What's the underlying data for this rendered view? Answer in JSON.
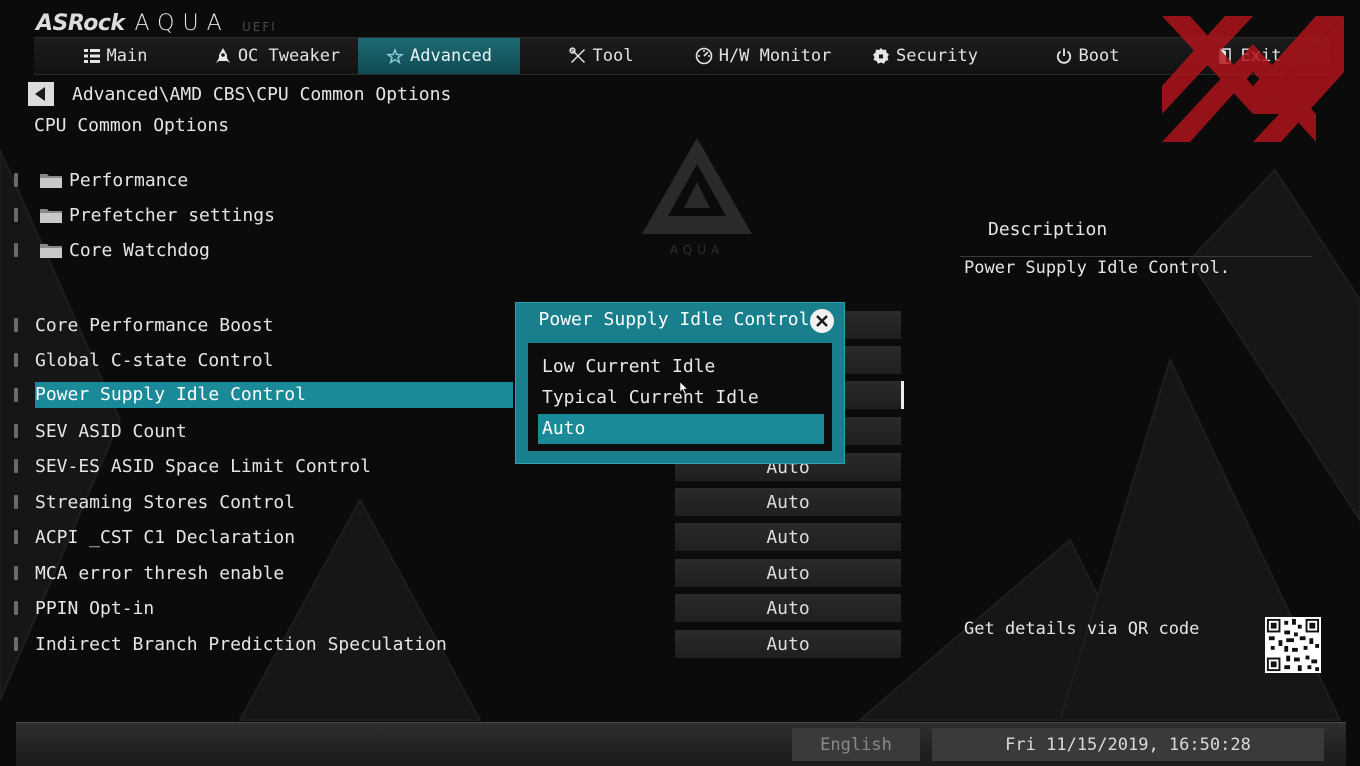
{
  "brand": {
    "logo": "ASRock",
    "product": "AQUA",
    "uefi": "UEFI"
  },
  "tabs": [
    {
      "label": "Main",
      "icon": "list-icon",
      "active": false
    },
    {
      "label": "OC Tweaker",
      "icon": "rocket-icon",
      "active": false
    },
    {
      "label": "Advanced",
      "icon": "star-icon",
      "active": true
    },
    {
      "label": "Tool",
      "icon": "tools-icon",
      "active": false
    },
    {
      "label": "H/W Monitor",
      "icon": "gauge-icon",
      "active": false
    },
    {
      "label": "Security",
      "icon": "shield-icon",
      "active": false
    },
    {
      "label": "Boot",
      "icon": "power-icon",
      "active": false
    },
    {
      "label": "Exit",
      "icon": "exit-icon",
      "active": false
    }
  ],
  "breadcrumb": "Advanced\\AMD CBS\\CPU Common Options",
  "page_title": "CPU Common Options",
  "submenus": [
    "Performance",
    "Prefetcher settings",
    "Core Watchdog"
  ],
  "settings": [
    {
      "label": "Core Performance Boost",
      "value": ""
    },
    {
      "label": "Global C-state Control",
      "value": ""
    },
    {
      "label": "Power Supply Idle Control",
      "value": "",
      "selected": true
    },
    {
      "label": "SEV ASID Count",
      "value": ""
    },
    {
      "label": "SEV-ES ASID Space Limit Control",
      "value": "Auto"
    },
    {
      "label": "Streaming Stores Control",
      "value": "Auto"
    },
    {
      "label": "ACPI _CST C1 Declaration",
      "value": "Auto"
    },
    {
      "label": "MCA error thresh enable",
      "value": "Auto"
    },
    {
      "label": "PPIN Opt-in",
      "value": "Auto"
    },
    {
      "label": "Indirect Branch Prediction Speculation",
      "value": "Auto"
    }
  ],
  "popup": {
    "title": "Power Supply Idle Control",
    "options": [
      "Low Current Idle",
      "Typical Current Idle",
      "Auto"
    ],
    "selected_index": 2
  },
  "description": {
    "heading": "Description",
    "text": "Power Supply Idle Control.",
    "qr_text": "Get details via QR code"
  },
  "footer": {
    "language": "English",
    "datetime": "Fri 11/15/2019, 16:50:28"
  },
  "colors": {
    "accent": "#1a8a99",
    "tab_active": "#104a52",
    "watermark_red": "#b3141b"
  }
}
